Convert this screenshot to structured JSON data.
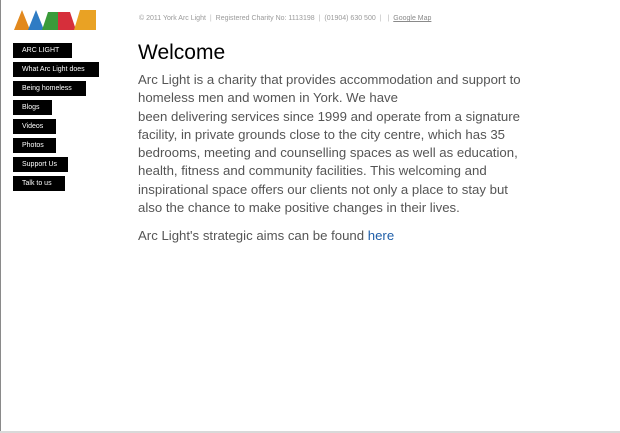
{
  "footer": {
    "copyright": "© 2011 York Arc Light",
    "charity": "Registered Charity No: 1113198",
    "phone": "(01904) 630 500",
    "map_link": "Google Map"
  },
  "logo": {
    "colors": [
      "#e2891e",
      "#2f7cc4",
      "#3a9b3a",
      "#d62f3b",
      "#e9a224"
    ]
  },
  "nav": {
    "items": [
      {
        "label": "ARC LIGHT"
      },
      {
        "label": "What Arc Light does"
      },
      {
        "label": "Being homeless"
      },
      {
        "label": "Blogs"
      },
      {
        "label": "Videos"
      },
      {
        "label": "Photos"
      },
      {
        "label": "Support Us"
      },
      {
        "label": "Talk to us"
      }
    ]
  },
  "main": {
    "title": "Welcome",
    "lines": [
      "Arc Light is a charity that provides accommodation and support to",
      "homeless men and women in York. We have",
      "been delivering services since 1999 and operate from a signature",
      "facility, in private grounds close to the city centre, which has 35",
      "bedrooms, meeting and counselling spaces as well as education,",
      "health, fitness and community facilities. This welcoming and",
      "inspirational space offers our clients not only a place to stay but",
      "also the chance to make positive changes in their lives."
    ],
    "aims_text": "Arc Light's strategic aims can be found ",
    "aims_link": "here"
  }
}
